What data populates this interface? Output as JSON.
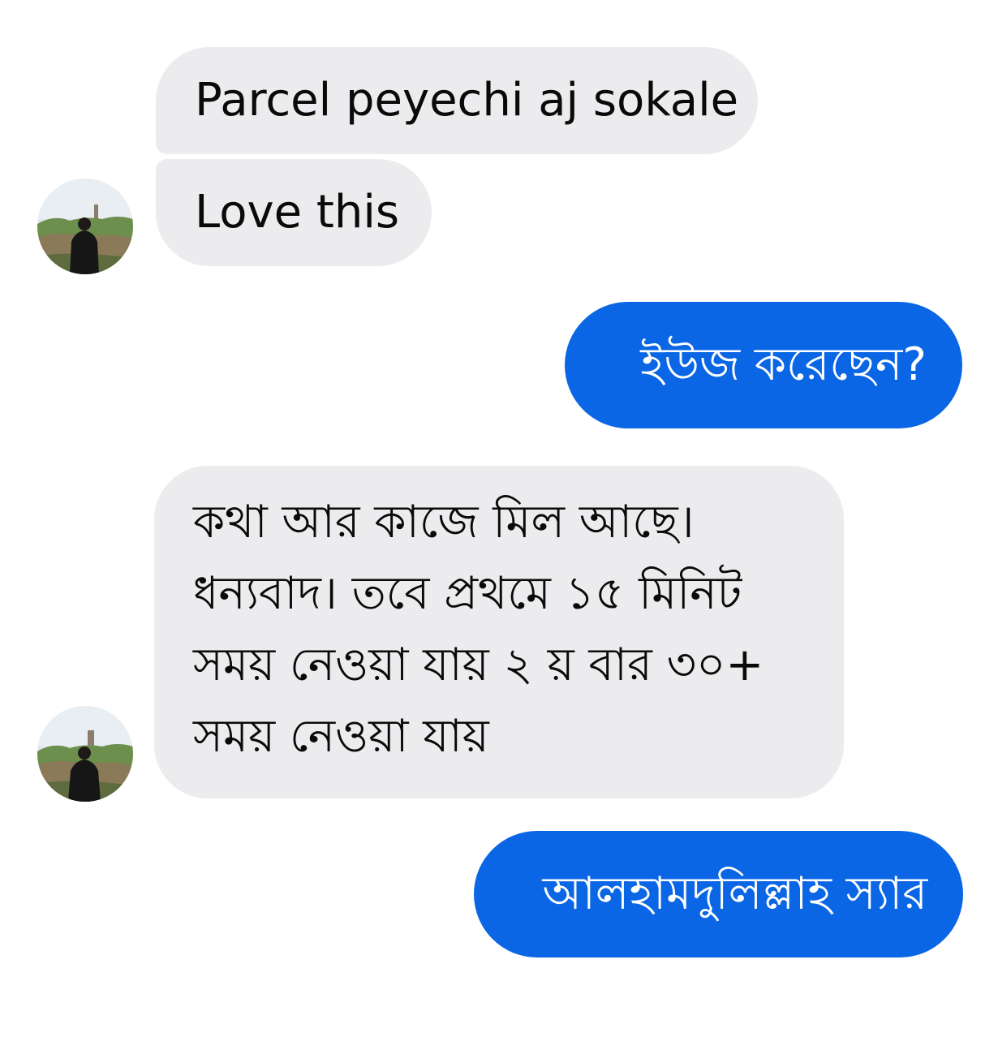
{
  "conversation": {
    "messages": [
      {
        "sender": "other",
        "text": "Parcel peyechi aj sokale"
      },
      {
        "sender": "other",
        "text": "Love this"
      },
      {
        "sender": "me",
        "text": "ইউজ করেছেন?"
      },
      {
        "sender": "other",
        "text": "কথা আর কাজে মিল আছে।\nধন্যবাদ। তবে প্রথমে ১৫ মিনিট\nসময় নেওয়া যায় ২ য় বার ৩০+\nসময় নেওয়া যায়"
      },
      {
        "sender": "me",
        "text": "আলহামদুলিল্লাহ স্যার"
      }
    ]
  },
  "colors": {
    "incoming_bubble": "#ececee",
    "outgoing_bubble": "#0a66e4",
    "background": "#ffffff"
  },
  "icons": {
    "avatar": "contact-avatar-photo"
  }
}
